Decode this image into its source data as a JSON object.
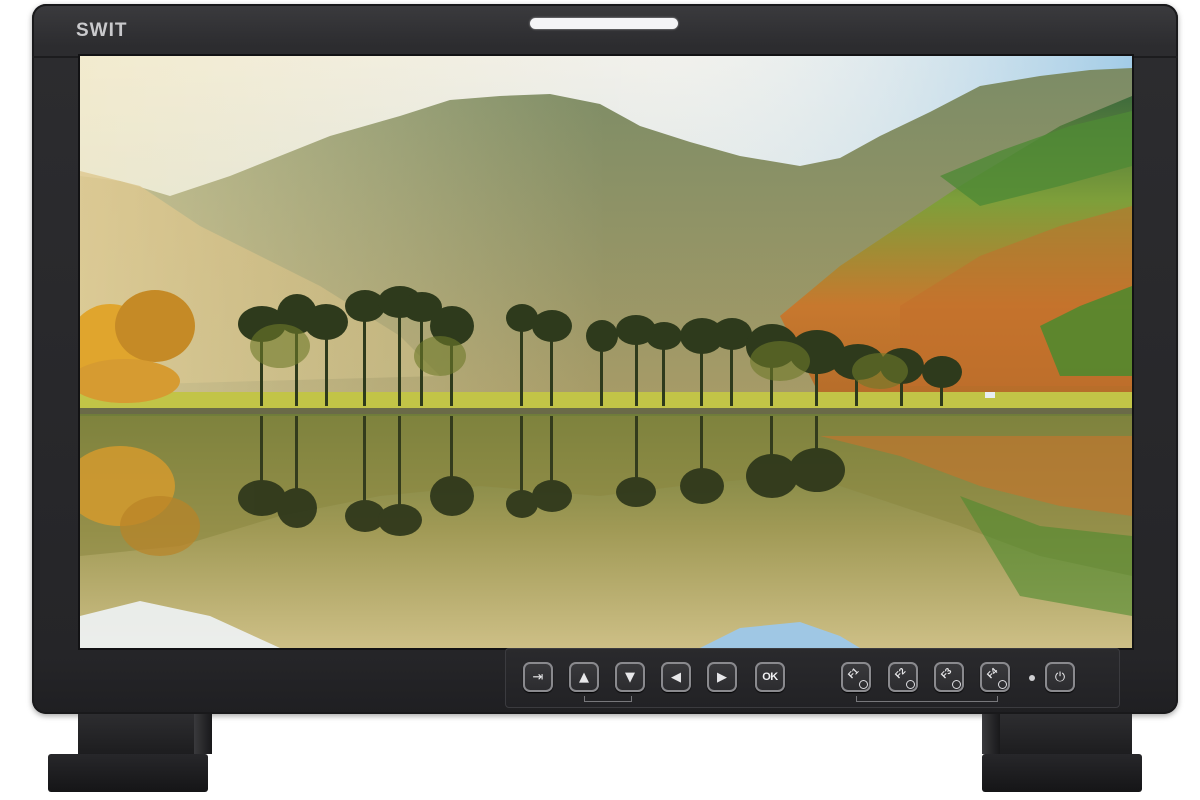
{
  "monitor": {
    "brand": "SWIT",
    "tally_light_color": "#f4f4f6",
    "bezel_color": "#2b2b2e",
    "screen_content": "landscape-image"
  },
  "controls": {
    "buttons": [
      {
        "id": "input",
        "icon": "input-select-icon",
        "glyph": "⇥"
      },
      {
        "id": "up",
        "icon": "arrow-up-icon",
        "glyph": "▲"
      },
      {
        "id": "down",
        "icon": "arrow-down-icon",
        "glyph": "▼"
      },
      {
        "id": "left",
        "icon": "arrow-left-icon",
        "glyph": "◀"
      },
      {
        "id": "right",
        "icon": "arrow-right-icon",
        "glyph": "▶"
      },
      {
        "id": "ok",
        "label": "OK"
      },
      {
        "id": "f1",
        "label": "F1"
      },
      {
        "id": "f2",
        "label": "F2"
      },
      {
        "id": "f3",
        "label": "F3"
      },
      {
        "id": "f4",
        "label": "F4"
      },
      {
        "id": "power",
        "icon": "power-icon",
        "glyph": "⏻"
      }
    ]
  }
}
